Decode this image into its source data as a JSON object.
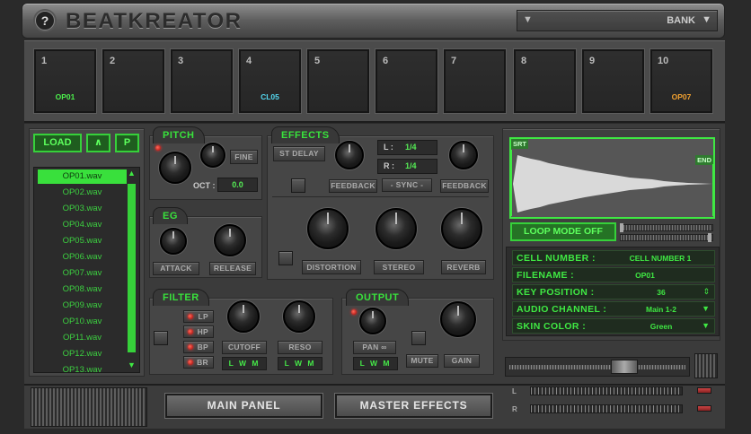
{
  "header": {
    "help_label": "?",
    "title": "BEATKREATOR",
    "bank_label": "BANK",
    "arrow_left": "▼",
    "arrow_right": "▼"
  },
  "pads": [
    {
      "num": "1",
      "label": "OP01",
      "color": "#4cf04c"
    },
    {
      "num": "2",
      "label": "",
      "color": "#4cf04c"
    },
    {
      "num": "3",
      "label": "",
      "color": "#4cf04c"
    },
    {
      "num": "4",
      "label": "CL05",
      "color": "#54d8f0"
    },
    {
      "num": "5",
      "label": "",
      "color": "#4cf04c"
    },
    {
      "num": "6",
      "label": "",
      "color": "#4cf04c"
    },
    {
      "num": "7",
      "label": "",
      "color": "#4cf04c"
    },
    {
      "num": "8",
      "label": "",
      "color": "#4cf04c"
    },
    {
      "num": "9",
      "label": "",
      "color": "#4cf04c"
    },
    {
      "num": "10",
      "label": "OP07",
      "color": "#f0a030"
    }
  ],
  "file_browser": {
    "load_label": "LOAD",
    "up_label": "∧",
    "p_label": "P",
    "selected_index": 0,
    "files": [
      "OP01.wav",
      "OP02.wav",
      "OP03.wav",
      "OP04.wav",
      "OP05.wav",
      "OP06.wav",
      "OP07.wav",
      "OP08.wav",
      "OP09.wav",
      "OP10.wav",
      "OP11.wav",
      "OP12.wav",
      "OP13.wav"
    ],
    "scroll_up": "▲",
    "scroll_down": "▼"
  },
  "pitch": {
    "title": "PITCH",
    "fine_label": "FINE",
    "oct_label": "OCT :",
    "oct_value": "0.0"
  },
  "eg": {
    "title": "EG",
    "attack_label": "ATTACK",
    "release_label": "RELEASE"
  },
  "effects": {
    "title": "EFFECTS",
    "st_delay_label": "ST DELAY",
    "l_label": "L :",
    "l_value": "1/4",
    "r_label": "R :",
    "r_value": "1/4",
    "feedback_left_label": "FEEDBACK",
    "sync_label": "- SYNC -",
    "feedback_right_label": "FEEDBACK",
    "distortion_label": "DISTORTION",
    "stereo_label": "STEREO",
    "reverb_label": "REVERB"
  },
  "filter": {
    "title": "FILTER",
    "modes": [
      "LP",
      "HP",
      "BP",
      "BR"
    ],
    "cutoff_label": "CUTOFF",
    "reso_label": "RESO",
    "cutoff_lwm": "L W M",
    "reso_lwm": "L W M"
  },
  "output": {
    "title": "OUTPUT",
    "pan_label": "PAN ∞",
    "pan_lwm": "L W M",
    "mute_label": "MUTE",
    "gain_label": "GAIN"
  },
  "waveform": {
    "start_label": "SRT",
    "end_label": "END",
    "loop_mode_label": "LOOP MODE OFF"
  },
  "cell_info": [
    {
      "key": "CELL NUMBER :",
      "value": "CELL NUMBER 1",
      "arrow": ""
    },
    {
      "key": "FILENAME :",
      "value": "OP01",
      "arrow": ""
    },
    {
      "key": "KEY POSITION :",
      "value": "36",
      "arrow": "⇕"
    },
    {
      "key": "AUDIO CHANNEL :",
      "value": "Main 1-2",
      "arrow": "▼"
    },
    {
      "key": "SKIN COLOR :",
      "value": "Green",
      "arrow": "▼"
    }
  ],
  "meters": {
    "l_label": "L",
    "r_label": "R"
  },
  "bottom": {
    "main_panel_label": "MAIN PANEL",
    "master_effects_label": "MASTER EFFECTS"
  },
  "colors": {
    "accent_green": "#3fe843",
    "panel": "#464646",
    "led_red": "#ff2a2a"
  }
}
